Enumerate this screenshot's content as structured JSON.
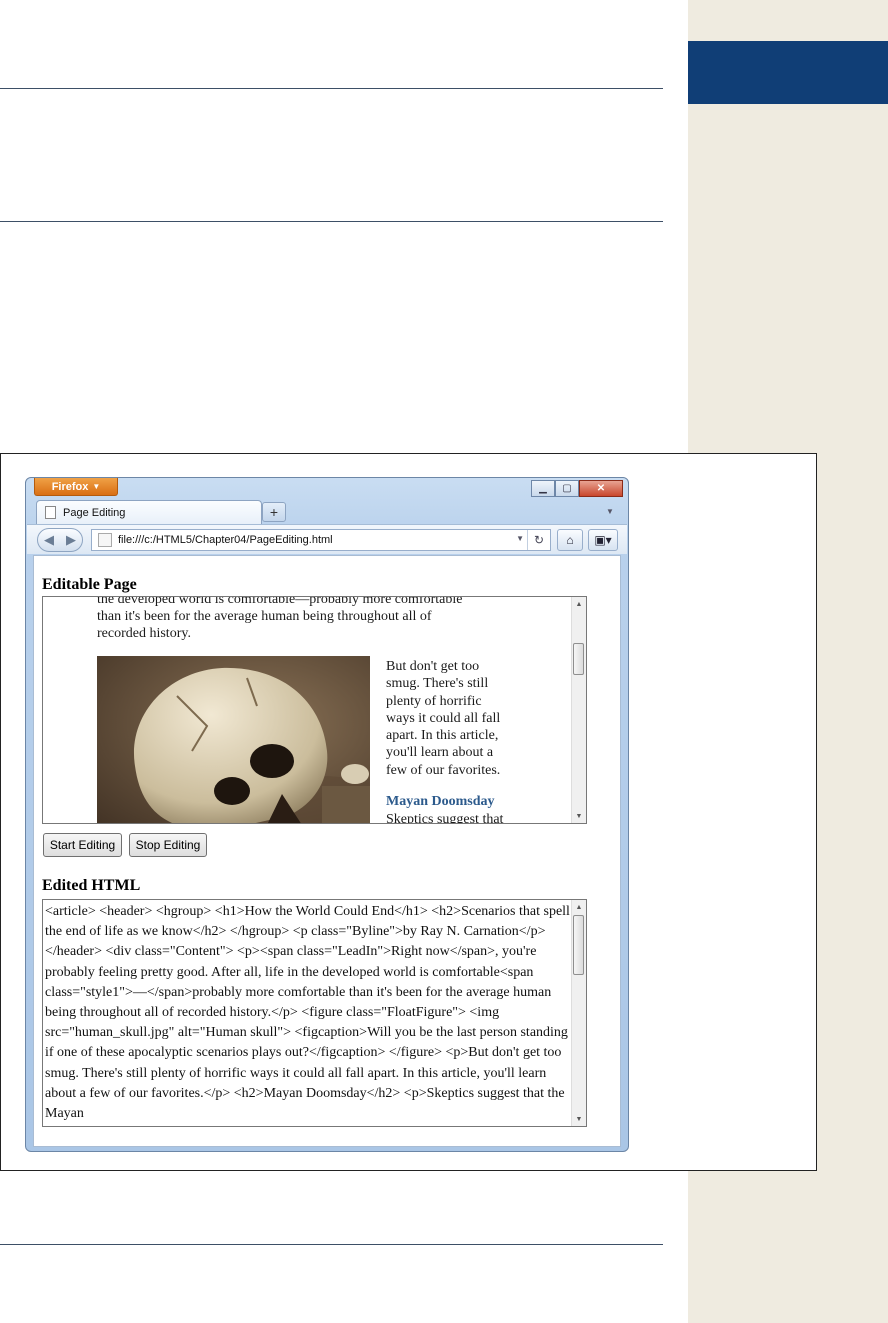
{
  "colors": {
    "side_strip": "#efebe0",
    "side_tab": "#103e76",
    "rule": "#3d4f66",
    "firefox_button": "#e07a1c",
    "heading_link": "#2c5a8c"
  },
  "browser": {
    "app_button": "Firefox",
    "tab_title": "Page Editing",
    "url": "file:///c:/HTML5/Chapter04/PageEditing.html"
  },
  "page": {
    "editable_heading": "Editable Page",
    "editable": {
      "lines_top": [
        "the developed world is comfortable—probably more comfortable",
        "than it's been for the average human being throughout all of",
        "recorded history."
      ],
      "image_alt": "Human skull",
      "float_lines": [
        "But don't get too",
        "smug. There's still",
        "plenty of horrific",
        "ways it could all fall",
        "apart. In this article,",
        "you'll learn about a",
        "few of our favorites."
      ],
      "subheading": "Mayan Doomsday",
      "next_line": "Skeptics suggest that"
    },
    "buttons": {
      "start": "Start Editing",
      "stop": "Stop Editing"
    },
    "edited_heading": "Edited HTML",
    "edited_html": "<article> <header> <hgroup> <h1>How the World Could End</h1> <h2>Scenarios that spell the end of life as we know</h2> </hgroup> <p class=\"Byline\">by Ray N. Carnation</p> </header> <div class=\"Content\"> <p><span class=\"LeadIn\">Right now</span>, you're probably feeling pretty good. After all, life in the developed world is comfortable<span class=\"style1\">—</span>probably more comfortable than it's been for the average human being throughout all of recorded history.</p> <figure class=\"FloatFigure\"> <img src=\"human_skull.jpg\" alt=\"Human skull\"> <figcaption>Will you be the last person standing if one of these apocalyptic scenarios plays out?</figcaption> </figure> <p>But don't get too smug. There's still plenty of horrific ways it could all fall apart. In this article, you'll learn about a few of our favorites.</p> <h2>Mayan Doomsday</h2> <p>Skeptics suggest that the Mayan"
  }
}
